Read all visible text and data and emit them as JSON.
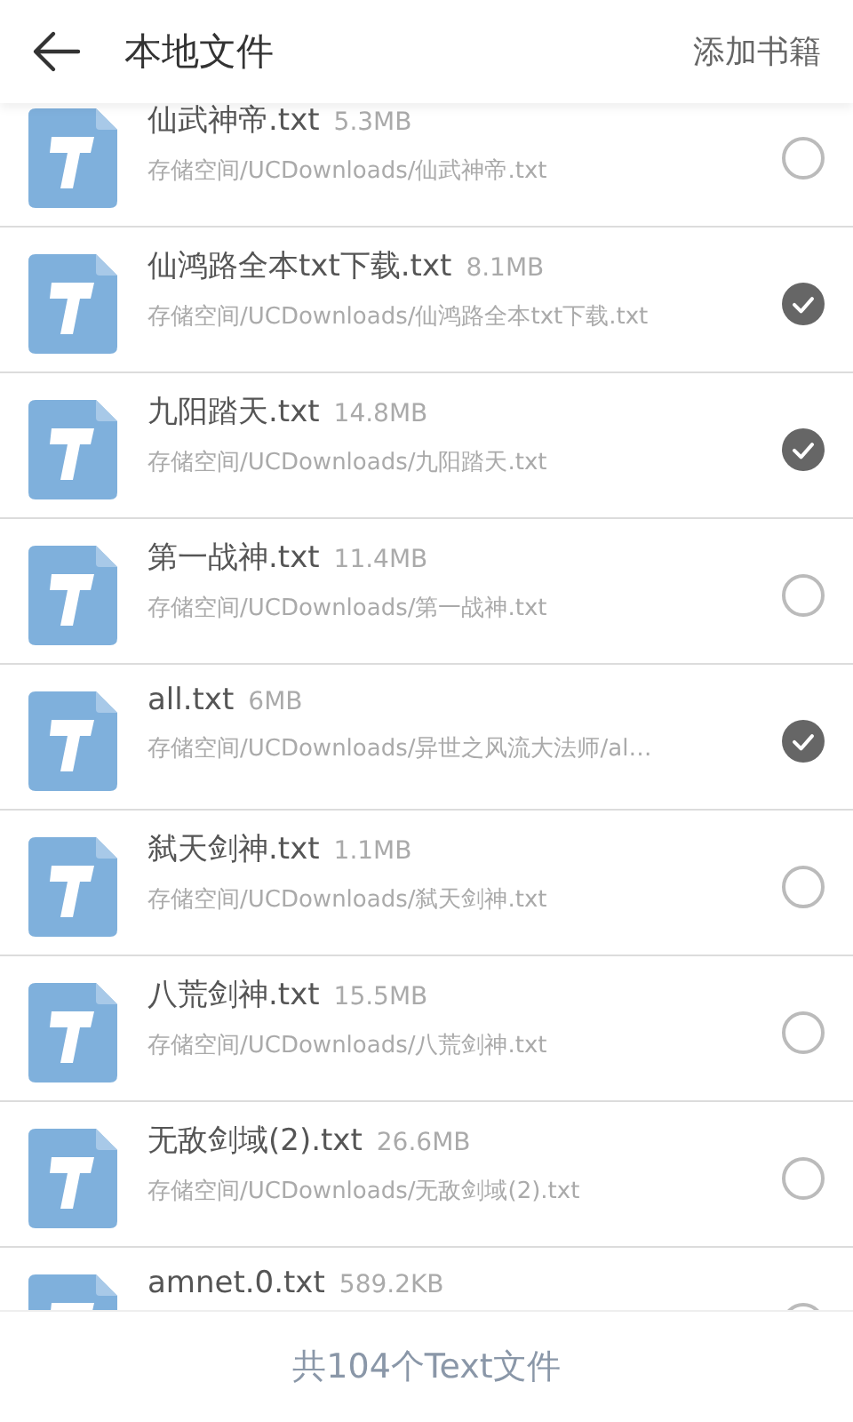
{
  "header": {
    "title": "本地文件",
    "action": "添加书籍"
  },
  "files": [
    {
      "name": "仙武神帝.txt",
      "size": "5.3MB",
      "path": "存储空间/UCDownloads/仙武神帝.txt",
      "selected": false
    },
    {
      "name": "仙鸿路全本txt下载.txt",
      "size": "8.1MB",
      "path": "存储空间/UCDownloads/仙鸿路全本txt下载.txt",
      "selected": true
    },
    {
      "name": "九阳踏天.txt",
      "size": "14.8MB",
      "path": "存储空间/UCDownloads/九阳踏天.txt",
      "selected": true
    },
    {
      "name": "第一战神.txt",
      "size": "11.4MB",
      "path": "存储空间/UCDownloads/第一战神.txt",
      "selected": false
    },
    {
      "name": "all.txt",
      "size": "6MB",
      "path": "存储空间/UCDownloads/异世之风流大法师/al…",
      "selected": true
    },
    {
      "name": "弑天剑神.txt",
      "size": "1.1MB",
      "path": "存储空间/UCDownloads/弑天剑神.txt",
      "selected": false
    },
    {
      "name": "八荒剑神.txt",
      "size": "15.5MB",
      "path": "存储空间/UCDownloads/八荒剑神.txt",
      "selected": false
    },
    {
      "name": "无敌剑域(2).txt",
      "size": "26.6MB",
      "path": "存储空间/UCDownloads/无敌剑域(2).txt",
      "selected": false
    },
    {
      "name": "amnet.0.txt",
      "size": "589.2KB",
      "selected": false
    }
  ],
  "footer": {
    "summary": "共104个Text文件"
  }
}
